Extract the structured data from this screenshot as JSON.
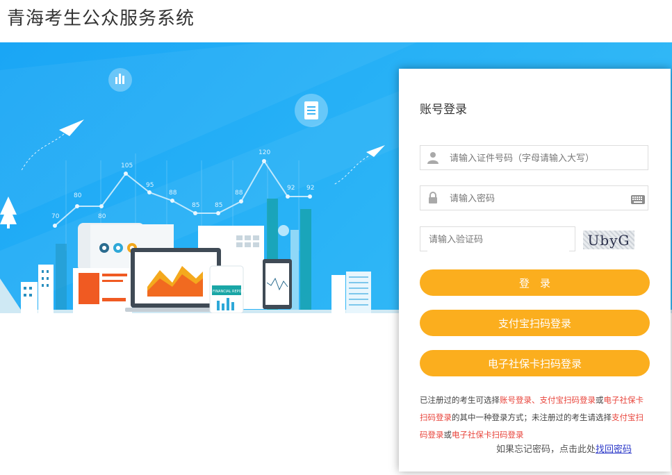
{
  "header": {
    "title": "青海考生公众服务系统"
  },
  "banner": {
    "chart_values": [
      "70",
      "80",
      "80",
      "105",
      "95",
      "88",
      "85",
      "85",
      "88",
      "120",
      "92",
      "92"
    ],
    "report_label": "FINANCIAL REPORT"
  },
  "login": {
    "title": "账号登录",
    "id_placeholder": "请输入证件号码（字母请输入大写）",
    "password_placeholder": "请输入密码",
    "captcha_placeholder": "请输入验证码",
    "captcha_text": "UbyG",
    "login_button": "登　录",
    "alipay_button": "支付宝扫码登录",
    "social_card_button": "电子社保卡扫码登录"
  },
  "notice": {
    "part1": "已注册过的考生可选择",
    "link1": "账号登录、支付宝扫码登录",
    "part2": "或",
    "link2": "电子社保卡扫码登录",
    "part3": "的其中一种登录方式；未注册过的考生请选择",
    "link3": "支付宝扫码登录",
    "part4": "或",
    "link4": "电子社保卡扫码登录"
  },
  "forgot": {
    "text": "如果忘记密码，点击此处",
    "link": "找回密码"
  },
  "colors": {
    "primary_button": "#fbae1e",
    "banner_blue": "#1aa6f5",
    "highlight": "#e8453c",
    "link": "#2b38c8"
  }
}
